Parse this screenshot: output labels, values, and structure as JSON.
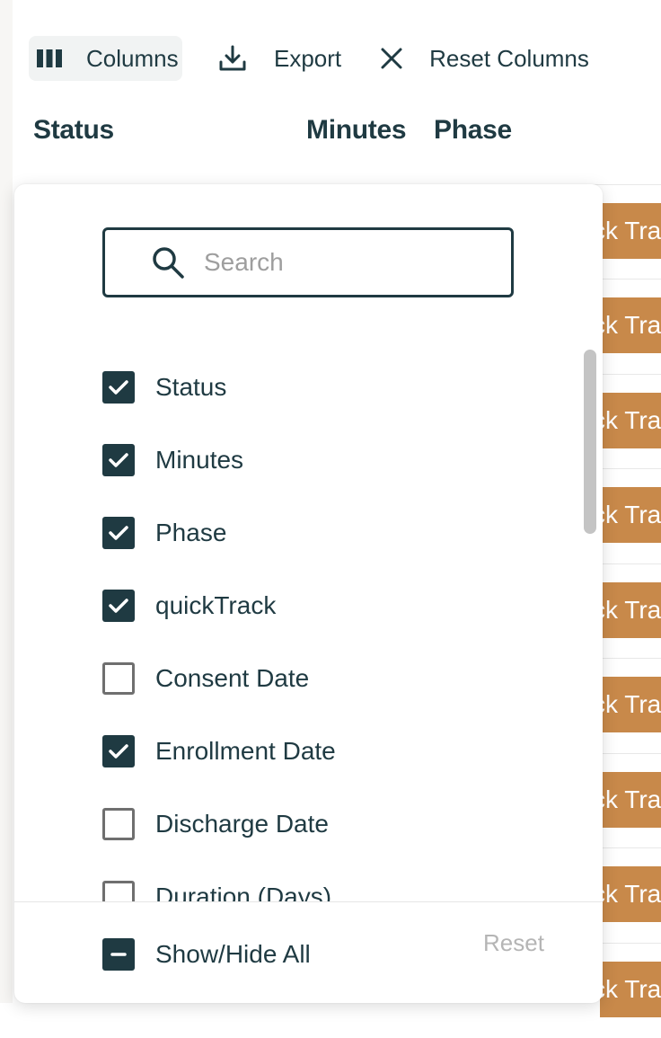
{
  "toolbar": {
    "columns_label": "Columns",
    "columns_icon": "columns-icon",
    "export_label": "Export",
    "export_icon": "download-icon",
    "reset_columns_label": "Reset Columns",
    "reset_columns_icon": "close-icon"
  },
  "table_header": {
    "status": "Status",
    "minutes": "Minutes",
    "phase": "Phase"
  },
  "background_badge_text": "ck Tra",
  "column_picker": {
    "search_placeholder": "Search",
    "search_value": "",
    "items": [
      {
        "label": "Status",
        "checked": true
      },
      {
        "label": "Minutes",
        "checked": true
      },
      {
        "label": "Phase",
        "checked": true
      },
      {
        "label": "quickTrack",
        "checked": true
      },
      {
        "label": "Consent Date",
        "checked": false
      },
      {
        "label": "Enrollment Date",
        "checked": true
      },
      {
        "label": "Discharge Date",
        "checked": false
      },
      {
        "label": "Duration (Days)",
        "checked": false
      }
    ],
    "show_hide_all_label": "Show/Hide All",
    "show_hide_all_state": "indeterminate",
    "reset_label": "Reset"
  },
  "colors": {
    "primary": "#1f3a42",
    "badge": "#c8894a",
    "muted": "#b5b5b5"
  }
}
